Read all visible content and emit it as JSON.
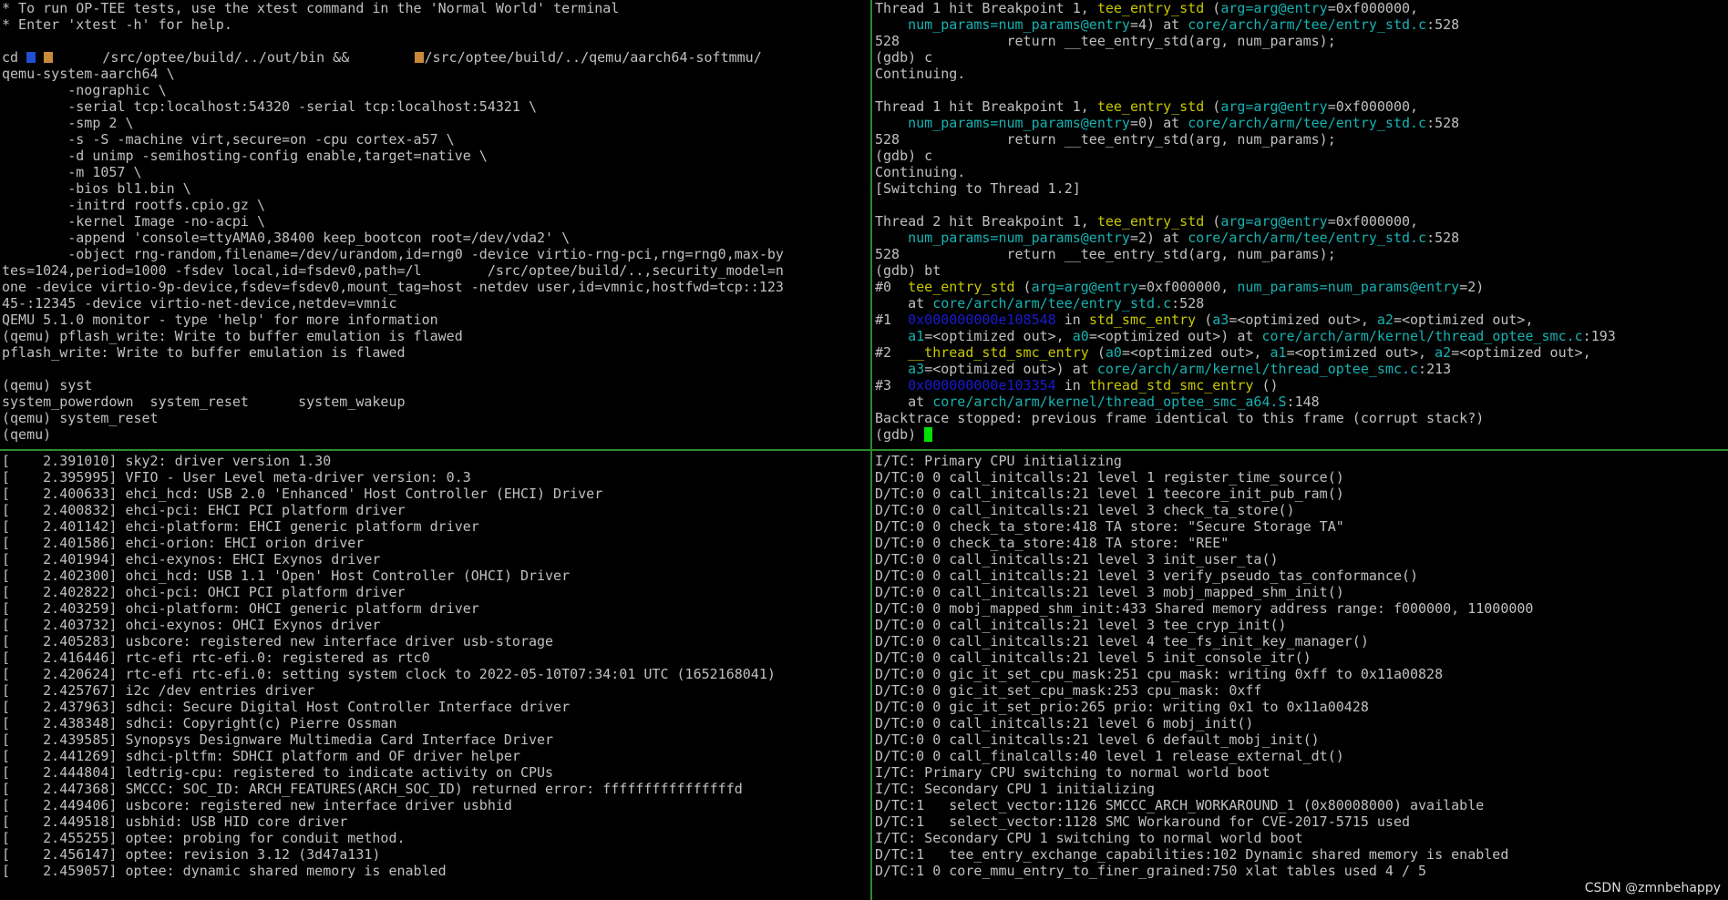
{
  "colors": {
    "background": "#000000",
    "text": "#c0c0c0",
    "function": "#c8c800",
    "param_and_path": "#18b2b2",
    "address": "#1a1ad0",
    "cursor": "#00e000",
    "divider": "#2e8b2e"
  },
  "watermark": "CSDN @zmnbehappy",
  "panes": {
    "normal_world": [
      [
        {
          "t": "* To run OP-TEE tests, use the xtest command in the 'Normal World' terminal"
        }
      ],
      [
        {
          "t": "* Enter 'xtest -h' for help."
        }
      ],
      [
        {
          "t": ""
        }
      ],
      [
        {
          "t": "cd "
        },
        {
          "c": "redact-blue"
        },
        {
          "t": " "
        },
        {
          "c": "redact-orange"
        },
        {
          "t": "      /src/optee/build/../out/bin && "
        },
        {
          "t": "       "
        },
        {
          "c": "redact-orange"
        },
        {
          "t": "/src/optee/build/../qemu/aarch64-softmmu/"
        }
      ],
      [
        {
          "t": "qemu-system-aarch64 \\"
        }
      ],
      [
        {
          "t": "        -nographic \\"
        }
      ],
      [
        {
          "t": "        -serial tcp:localhost:54320 -serial tcp:localhost:54321 \\"
        }
      ],
      [
        {
          "t": "        -smp 2 \\"
        }
      ],
      [
        {
          "t": "        -s -S -machine virt,secure=on -cpu cortex-a57 \\"
        }
      ],
      [
        {
          "t": "        -d unimp -semihosting-config enable,target=native \\"
        }
      ],
      [
        {
          "t": "        -m 1057 \\"
        }
      ],
      [
        {
          "t": "        -bios bl1.bin \\"
        }
      ],
      [
        {
          "t": "        -initrd rootfs.cpio.gz \\"
        }
      ],
      [
        {
          "t": "        -kernel Image -no-acpi \\"
        }
      ],
      [
        {
          "t": "        -append 'console=ttyAMA0,38400 keep_bootcon root=/dev/vda2' \\"
        }
      ],
      [
        {
          "t": "        -object rng-random,filename=/dev/urandom,id=rng0 -device virtio-rng-pci,rng=rng0,max-by"
        }
      ],
      [
        {
          "t": "tes=1024,period=1000 -fsdev local,id=fsdev0,path=/l        /src/optee/build/..,security_model=n"
        }
      ],
      [
        {
          "t": "one -device virtio-9p-device,fsdev=fsdev0,mount_tag=host -netdev user,id=vmnic,hostfwd=tcp::123"
        }
      ],
      [
        {
          "t": "45-:12345 -device virtio-net-device,netdev=vmnic"
        }
      ],
      [
        {
          "t": "QEMU 5.1.0 monitor - type 'help' for more information"
        }
      ],
      [
        {
          "t": "(qemu) pflash_write: Write to buffer emulation is flawed"
        }
      ],
      [
        {
          "t": "pflash_write: Write to buffer emulation is flawed"
        }
      ],
      [
        {
          "t": ""
        }
      ],
      [
        {
          "t": "(qemu) syst"
        }
      ],
      [
        {
          "t": "system_powerdown  system_reset      system_wakeup"
        }
      ],
      [
        {
          "t": "(qemu) system_reset"
        }
      ],
      [
        {
          "t": "(qemu)"
        }
      ]
    ],
    "gdb": [
      [
        {
          "t": "Thread 1 hit Breakpoint 1, "
        },
        {
          "t": "tee_entry_std",
          "c": "seg-fn"
        },
        {
          "t": " ("
        },
        {
          "t": "arg=arg@entry",
          "c": "seg-param"
        },
        {
          "t": "=0xf000000,"
        }
      ],
      [
        {
          "t": "    "
        },
        {
          "t": "num_params=num_params@entry",
          "c": "seg-param"
        },
        {
          "t": "=4) at "
        },
        {
          "t": "core/arch/arm/tee/entry_std.c",
          "c": "seg-path"
        },
        {
          "t": ":528"
        }
      ],
      [
        {
          "t": "528             return __tee_entry_std(arg, num_params);"
        }
      ],
      [
        {
          "t": "(gdb) c"
        }
      ],
      [
        {
          "t": "Continuing."
        }
      ],
      [
        {
          "t": ""
        }
      ],
      [
        {
          "t": "Thread 1 hit Breakpoint 1, "
        },
        {
          "t": "tee_entry_std",
          "c": "seg-fn"
        },
        {
          "t": " ("
        },
        {
          "t": "arg=arg@entry",
          "c": "seg-param"
        },
        {
          "t": "=0xf000000,"
        }
      ],
      [
        {
          "t": "    "
        },
        {
          "t": "num_params=num_params@entry",
          "c": "seg-param"
        },
        {
          "t": "=0) at "
        },
        {
          "t": "core/arch/arm/tee/entry_std.c",
          "c": "seg-path"
        },
        {
          "t": ":528"
        }
      ],
      [
        {
          "t": "528             return __tee_entry_std(arg, num_params);"
        }
      ],
      [
        {
          "t": "(gdb) c"
        }
      ],
      [
        {
          "t": "Continuing."
        }
      ],
      [
        {
          "t": "[Switching to Thread 1.2]"
        }
      ],
      [
        {
          "t": ""
        }
      ],
      [
        {
          "t": "Thread 2 hit Breakpoint 1, "
        },
        {
          "t": "tee_entry_std",
          "c": "seg-fn"
        },
        {
          "t": " ("
        },
        {
          "t": "arg=arg@entry",
          "c": "seg-param"
        },
        {
          "t": "=0xf000000,"
        }
      ],
      [
        {
          "t": "    "
        },
        {
          "t": "num_params=num_params@entry",
          "c": "seg-param"
        },
        {
          "t": "=2) at "
        },
        {
          "t": "core/arch/arm/tee/entry_std.c",
          "c": "seg-path"
        },
        {
          "t": ":528"
        }
      ],
      [
        {
          "t": "528             return __tee_entry_std(arg, num_params);"
        }
      ],
      [
        {
          "t": "(gdb) bt"
        }
      ],
      [
        {
          "t": "#0  "
        },
        {
          "t": "tee_entry_std",
          "c": "seg-fn"
        },
        {
          "t": " ("
        },
        {
          "t": "arg=arg@entry",
          "c": "seg-param"
        },
        {
          "t": "=0xf000000, "
        },
        {
          "t": "num_params=num_params@entry",
          "c": "seg-param"
        },
        {
          "t": "=2)"
        }
      ],
      [
        {
          "t": "    at "
        },
        {
          "t": "core/arch/arm/tee/entry_std.c",
          "c": "seg-path"
        },
        {
          "t": ":528"
        }
      ],
      [
        {
          "t": "#1  "
        },
        {
          "t": "0x000000000e108548",
          "c": "seg-addr"
        },
        {
          "t": " in "
        },
        {
          "t": "std_smc_entry",
          "c": "seg-fn"
        },
        {
          "t": " ("
        },
        {
          "t": "a3",
          "c": "seg-param"
        },
        {
          "t": "=<optimized out>, "
        },
        {
          "t": "a2",
          "c": "seg-param"
        },
        {
          "t": "=<optimized out>,"
        }
      ],
      [
        {
          "t": "    "
        },
        {
          "t": "a1",
          "c": "seg-param"
        },
        {
          "t": "=<optimized out>, "
        },
        {
          "t": "a0",
          "c": "seg-param"
        },
        {
          "t": "=<optimized out>) at "
        },
        {
          "t": "core/arch/arm/kernel/thread_optee_smc.c",
          "c": "seg-path"
        },
        {
          "t": ":193"
        }
      ],
      [
        {
          "t": "#2  "
        },
        {
          "t": "__thread_std_smc_entry",
          "c": "seg-fn"
        },
        {
          "t": " ("
        },
        {
          "t": "a0",
          "c": "seg-param"
        },
        {
          "t": "=<optimized out>, "
        },
        {
          "t": "a1",
          "c": "seg-param"
        },
        {
          "t": "=<optimized out>, "
        },
        {
          "t": "a2",
          "c": "seg-param"
        },
        {
          "t": "=<optimized out>,"
        }
      ],
      [
        {
          "t": "    "
        },
        {
          "t": "a3",
          "c": "seg-param"
        },
        {
          "t": "=<optimized out>) at "
        },
        {
          "t": "core/arch/arm/kernel/thread_optee_smc.c",
          "c": "seg-path"
        },
        {
          "t": ":213"
        }
      ],
      [
        {
          "t": "#3  "
        },
        {
          "t": "0x000000000e103354",
          "c": "seg-addr"
        },
        {
          "t": " in "
        },
        {
          "t": "thread_std_smc_entry",
          "c": "seg-fn"
        },
        {
          "t": " ()"
        }
      ],
      [
        {
          "t": "    at "
        },
        {
          "t": "core/arch/arm/kernel/thread_optee_smc_a64.S",
          "c": "seg-path"
        },
        {
          "t": ":148"
        }
      ],
      [
        {
          "t": "Backtrace stopped: previous frame identical to this frame (corrupt stack?)"
        }
      ],
      [
        {
          "t": "(gdb) "
        },
        {
          "c": "seg-cursor"
        }
      ]
    ],
    "linux_kernel": [
      [
        {
          "t": "[    2.391010] sky2: driver version 1.30"
        }
      ],
      [
        {
          "t": "[    2.395995] VFIO - User Level meta-driver version: 0.3"
        }
      ],
      [
        {
          "t": "[    2.400633] ehci_hcd: USB 2.0 'Enhanced' Host Controller (EHCI) Driver"
        }
      ],
      [
        {
          "t": "[    2.400832] ehci-pci: EHCI PCI platform driver"
        }
      ],
      [
        {
          "t": "[    2.401142] ehci-platform: EHCI generic platform driver"
        }
      ],
      [
        {
          "t": "[    2.401586] ehci-orion: EHCI orion driver"
        }
      ],
      [
        {
          "t": "[    2.401994] ehci-exynos: EHCI Exynos driver"
        }
      ],
      [
        {
          "t": "[    2.402300] ohci_hcd: USB 1.1 'Open' Host Controller (OHCI) Driver"
        }
      ],
      [
        {
          "t": "[    2.402822] ohci-pci: OHCI PCI platform driver"
        }
      ],
      [
        {
          "t": "[    2.403259] ohci-platform: OHCI generic platform driver"
        }
      ],
      [
        {
          "t": "[    2.403732] ohci-exynos: OHCI Exynos driver"
        }
      ],
      [
        {
          "t": "[    2.405283] usbcore: registered new interface driver usb-storage"
        }
      ],
      [
        {
          "t": "[    2.416446] rtc-efi rtc-efi.0: registered as rtc0"
        }
      ],
      [
        {
          "t": "[    2.420624] rtc-efi rtc-efi.0: setting system clock to 2022-05-10T07:34:01 UTC (1652168041)"
        }
      ],
      [
        {
          "t": "[    2.425767] i2c /dev entries driver"
        }
      ],
      [
        {
          "t": "[    2.437963] sdhci: Secure Digital Host Controller Interface driver"
        }
      ],
      [
        {
          "t": "[    2.438348] sdhci: Copyright(c) Pierre Ossman"
        }
      ],
      [
        {
          "t": "[    2.439585] Synopsys Designware Multimedia Card Interface Driver"
        }
      ],
      [
        {
          "t": "[    2.441269] sdhci-pltfm: SDHCI platform and OF driver helper"
        }
      ],
      [
        {
          "t": "[    2.444804] ledtrig-cpu: registered to indicate activity on CPUs"
        }
      ],
      [
        {
          "t": "[    2.447368] SMCCC: SOC_ID: ARCH_FEATURES(ARCH_SOC_ID) returned error: ffffffffffffffffd"
        }
      ],
      [
        {
          "t": "[    2.449406] usbcore: registered new interface driver usbhid"
        }
      ],
      [
        {
          "t": "[    2.449518] usbhid: USB HID core driver"
        }
      ],
      [
        {
          "t": "[    2.455255] optee: probing for conduit method."
        }
      ],
      [
        {
          "t": "[    2.456147] optee: revision 3.12 (3d47a131)"
        }
      ],
      [
        {
          "t": "[    2.459057] optee: dynamic shared memory is enabled"
        }
      ]
    ],
    "secure_world": [
      [
        {
          "t": "I/TC: Primary CPU initializing"
        }
      ],
      [
        {
          "t": "D/TC:0 0 call_initcalls:21 level 1 register_time_source()"
        }
      ],
      [
        {
          "t": "D/TC:0 0 call_initcalls:21 level 1 teecore_init_pub_ram()"
        }
      ],
      [
        {
          "t": "D/TC:0 0 call_initcalls:21 level 3 check_ta_store()"
        }
      ],
      [
        {
          "t": "D/TC:0 0 check_ta_store:418 TA store: \"Secure Storage TA\""
        }
      ],
      [
        {
          "t": "D/TC:0 0 check_ta_store:418 TA store: \"REE\""
        }
      ],
      [
        {
          "t": "D/TC:0 0 call_initcalls:21 level 3 init_user_ta()"
        }
      ],
      [
        {
          "t": "D/TC:0 0 call_initcalls:21 level 3 verify_pseudo_tas_conformance()"
        }
      ],
      [
        {
          "t": "D/TC:0 0 call_initcalls:21 level 3 mobj_mapped_shm_init()"
        }
      ],
      [
        {
          "t": "D/TC:0 0 mobj_mapped_shm_init:433 Shared memory address range: f000000, 11000000"
        }
      ],
      [
        {
          "t": "D/TC:0 0 call_initcalls:21 level 3 tee_cryp_init()"
        }
      ],
      [
        {
          "t": "D/TC:0 0 call_initcalls:21 level 4 tee_fs_init_key_manager()"
        }
      ],
      [
        {
          "t": "D/TC:0 0 call_initcalls:21 level 5 init_console_itr()"
        }
      ],
      [
        {
          "t": "D/TC:0 0 gic_it_set_cpu_mask:251 cpu_mask: writing 0xff to 0x11a00828"
        }
      ],
      [
        {
          "t": "D/TC:0 0 gic_it_set_cpu_mask:253 cpu_mask: 0xff"
        }
      ],
      [
        {
          "t": "D/TC:0 0 gic_it_set_prio:265 prio: writing 0x1 to 0x11a00428"
        }
      ],
      [
        {
          "t": "D/TC:0 0 call_initcalls:21 level 6 mobj_init()"
        }
      ],
      [
        {
          "t": "D/TC:0 0 call_initcalls:21 level 6 default_mobj_init()"
        }
      ],
      [
        {
          "t": "D/TC:0 0 call_finalcalls:40 level 1 release_external_dt()"
        }
      ],
      [
        {
          "t": "I/TC: Primary CPU switching to normal world boot"
        }
      ],
      [
        {
          "t": "I/TC: Secondary CPU 1 initializing"
        }
      ],
      [
        {
          "t": "D/TC:1   select_vector:1126 SMCCC_ARCH_WORKAROUND_1 (0x80008000) available"
        }
      ],
      [
        {
          "t": "D/TC:1   select_vector:1128 SMC Workaround for CVE-2017-5715 used"
        }
      ],
      [
        {
          "t": "I/TC: Secondary CPU 1 switching to normal world boot"
        }
      ],
      [
        {
          "t": "D/TC:1   tee_entry_exchange_capabilities:102 Dynamic shared memory is enabled"
        }
      ],
      [
        {
          "t": "D/TC:1 0 core_mmu_entry_to_finer_grained:750 xlat tables used 4 / 5"
        }
      ]
    ]
  }
}
